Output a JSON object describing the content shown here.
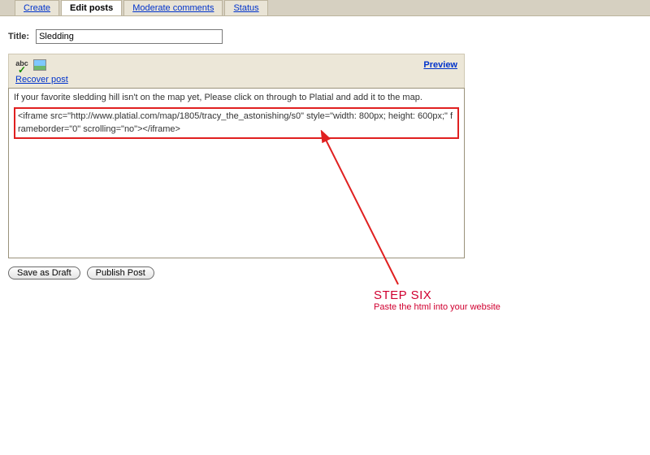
{
  "tabs": {
    "create": "Create",
    "edit": "Edit posts",
    "moderate": "Moderate comments",
    "status": "Status"
  },
  "title_label": "Title:",
  "title_value": "Sledding",
  "toolbar": {
    "spell_label": "abc",
    "preview_label": "Preview",
    "recover_label": "Recover post"
  },
  "editor": {
    "line1": "If your favorite sledding hill isn't on the map yet, Please click on through to Platial and add it to the map.",
    "code": "<iframe src=\"http://www.platial.com/map/1805/tracy_the_astonishing/s0\" style=\"width: 800px; height: 600px;\" frameborder=\"0\" scrolling=\"no\"></iframe>"
  },
  "buttons": {
    "draft": "Save as Draft",
    "publish": "Publish Post"
  },
  "annotation": {
    "step": "STEP SIX",
    "sub": "Paste the html into your website"
  }
}
